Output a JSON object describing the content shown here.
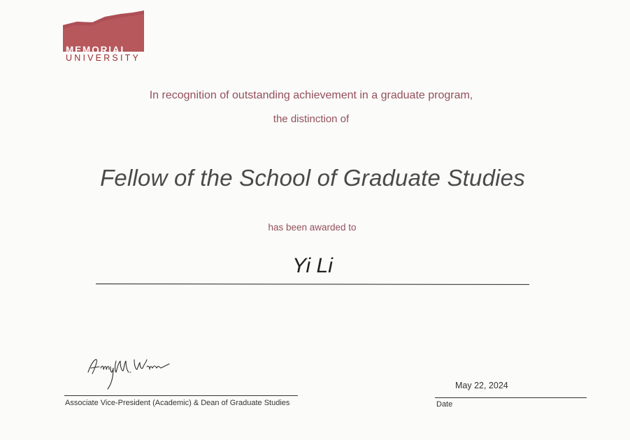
{
  "logo": {
    "line1": "MEMORIAL",
    "line2": "UNIVERSITY",
    "color": "#b6585c"
  },
  "certificate": {
    "recognition_line1": "In recognition of outstanding achievement in a graduate program,",
    "recognition_line2": "the distinction of",
    "distinction": "Fellow of the School of Graduate Studies",
    "awarded_text": "has been awarded to",
    "recipient": "Yi Li"
  },
  "signature": {
    "handwriting": "Amy M. Warren",
    "title": "Associate Vice-President (Academic) & Dean  of  Graduate Studies"
  },
  "date": {
    "value": "May 22, 2024",
    "label": "Date"
  },
  "colors": {
    "accent_text": "#93505a",
    "logo_red": "#b6585c"
  }
}
